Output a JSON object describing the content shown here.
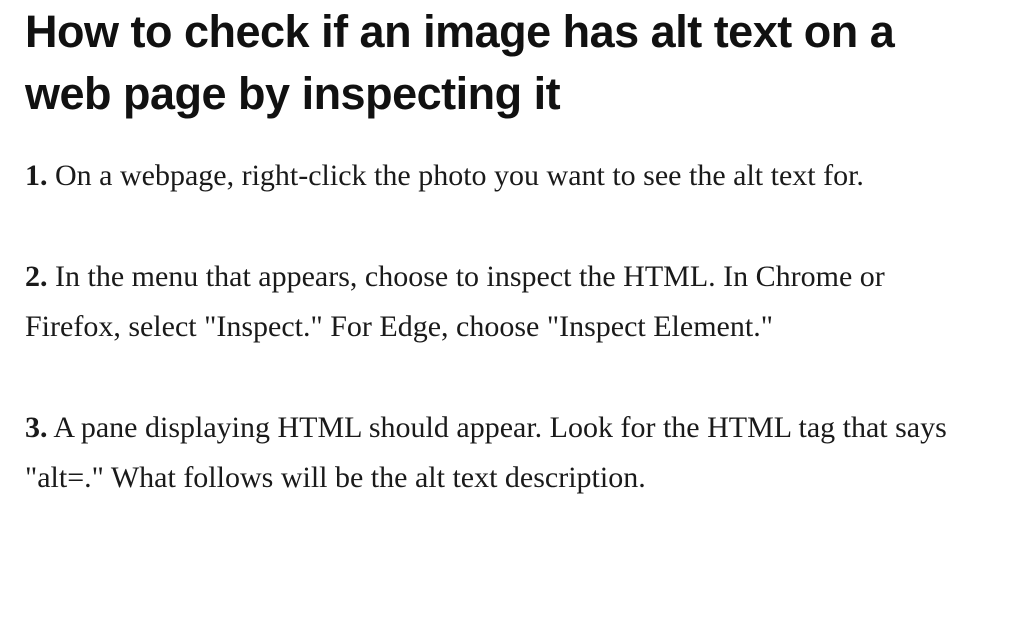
{
  "article": {
    "title": "How to check if an image has alt text on a web page by inspecting it",
    "steps": [
      {
        "number": "1.",
        "text": "On a webpage, right-click the photo you want to see the alt text for."
      },
      {
        "number": "2.",
        "text": "In the menu that appears, choose to inspect the HTML. In Chrome or Firefox, select \"Inspect.\" For Edge, choose \"Inspect Element.\""
      },
      {
        "number": "3.",
        "text": "A pane displaying HTML should appear. Look for the HTML tag that says \"alt=.\" What follows will be the alt text description."
      }
    ]
  }
}
